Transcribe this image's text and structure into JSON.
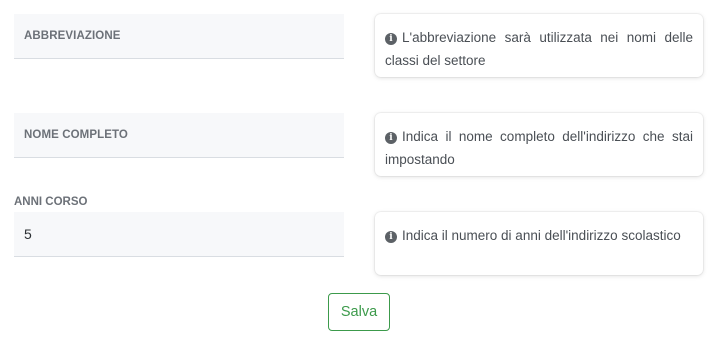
{
  "form": {
    "fields": [
      {
        "label": "ABBREVIAZIONE",
        "value": "",
        "hint": "L'abbreviazione sarà utilizzata nei nomi delle classi del settore"
      },
      {
        "label": "NOME COMPLETO",
        "value": "",
        "hint": "Indica il nome completo dell'indirizzo che stai impostando"
      },
      {
        "label": "ANNI CORSO",
        "value": "5",
        "hint": "Indica il numero di anni dell'indirizzo scolastico"
      }
    ],
    "info_icon": "info-circle-icon",
    "save_label": "Salva"
  },
  "colors": {
    "accent_green": "#3c9a4b",
    "field_background": "#f7f8fa"
  }
}
